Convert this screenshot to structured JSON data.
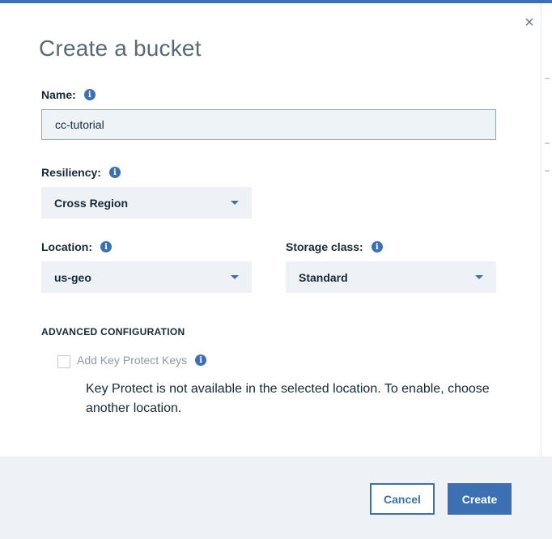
{
  "modal": {
    "title": "Create a bucket",
    "close_icon": "close-icon",
    "close_glyph": "×"
  },
  "name_field": {
    "label": "Name:",
    "value": "cc-tutorial"
  },
  "resiliency": {
    "label": "Resiliency:",
    "selected": "Cross Region"
  },
  "location": {
    "label": "Location:",
    "selected": "us-geo"
  },
  "storage_class": {
    "label": "Storage class:",
    "selected": "Standard"
  },
  "advanced": {
    "heading": "ADVANCED CONFIGURATION",
    "key_protect_label": "Add Key Protect Keys",
    "key_protect_checked": false,
    "note": "Key Protect is not available in the selected location. To enable, choose another location."
  },
  "info_glyph": "i",
  "buttons": {
    "cancel": "Cancel",
    "create": "Create"
  },
  "colors": {
    "accent": "#3d70b2",
    "footer_bg": "#eef1f5",
    "input_bg": "#eef3f8"
  }
}
